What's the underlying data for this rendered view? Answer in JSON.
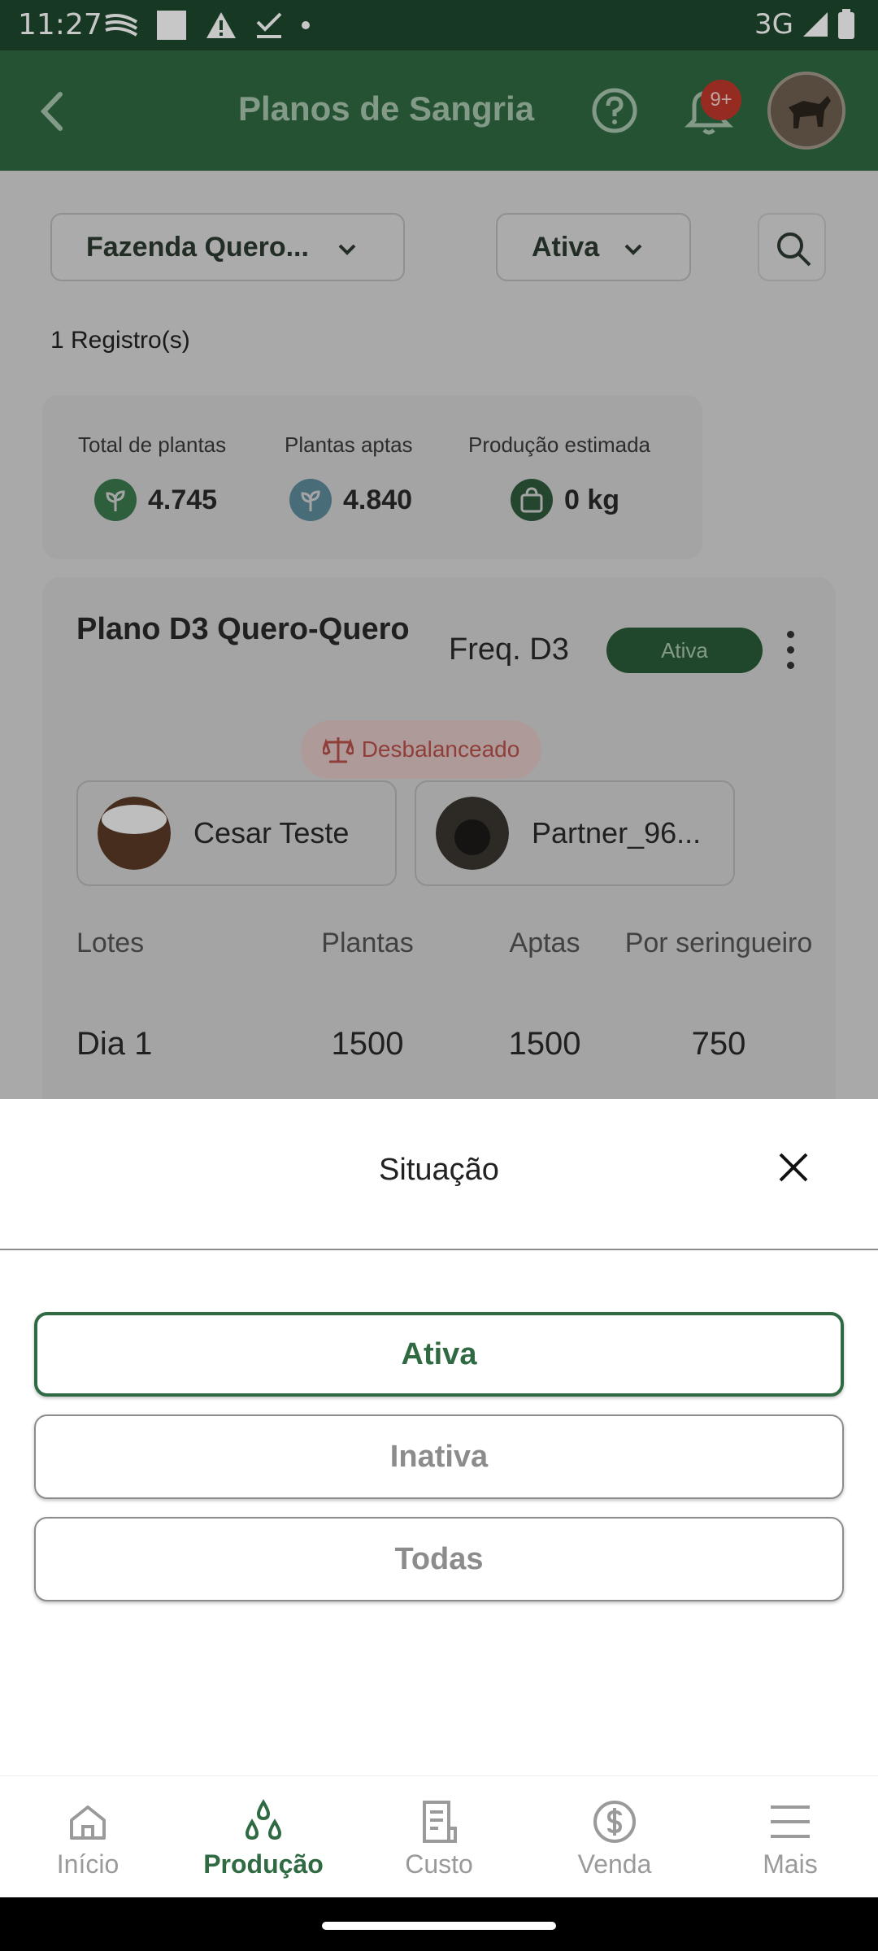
{
  "status_bar": {
    "time": "11:27",
    "network": "3G",
    "icons": [
      "notification-lines-icon",
      "square-icon",
      "warning-icon",
      "check-download-icon",
      "dot-icon",
      "signal-icon",
      "battery-icon"
    ]
  },
  "app_bar": {
    "title": "Planos de Sangria",
    "notification_badge": "9+",
    "icons": [
      "back-arrow-icon",
      "help-icon",
      "bell-icon",
      "avatar"
    ]
  },
  "filters": {
    "farm": "Fazenda Quero...",
    "status": "Ativa"
  },
  "records_count": "1 Registro(s)",
  "summary": {
    "total_plants_label": "Total de plantas",
    "total_plants_value": "4.745",
    "apt_plants_label": "Plantas aptas",
    "apt_plants_value": "4.840",
    "estimated_production_label": "Produção estimada",
    "estimated_production_value": "0 kg"
  },
  "plan": {
    "name": "Plano D3 Quero-Quero",
    "frequency": "Freq. D3",
    "status": "Ativa",
    "balance_status": "Desbalanceado",
    "members": [
      "Cesar Teste",
      "Partner_96..."
    ],
    "table": {
      "headers": [
        "Lotes",
        "Plantas",
        "Aptas",
        "Por seringueiro"
      ],
      "rows": [
        [
          "Dia 1",
          "1500",
          "1500",
          "750"
        ]
      ]
    }
  },
  "sheet": {
    "title": "Situação",
    "options": [
      "Ativa",
      "Inativa",
      "Todas"
    ],
    "selected": "Ativa"
  },
  "bottom_nav": {
    "items": [
      "Início",
      "Produção",
      "Custo",
      "Venda",
      "Mais"
    ],
    "active": "Produção"
  },
  "colors": {
    "primary": "#2f6a42",
    "status_bar": "#1e4a2e",
    "danger": "#c0392b"
  }
}
